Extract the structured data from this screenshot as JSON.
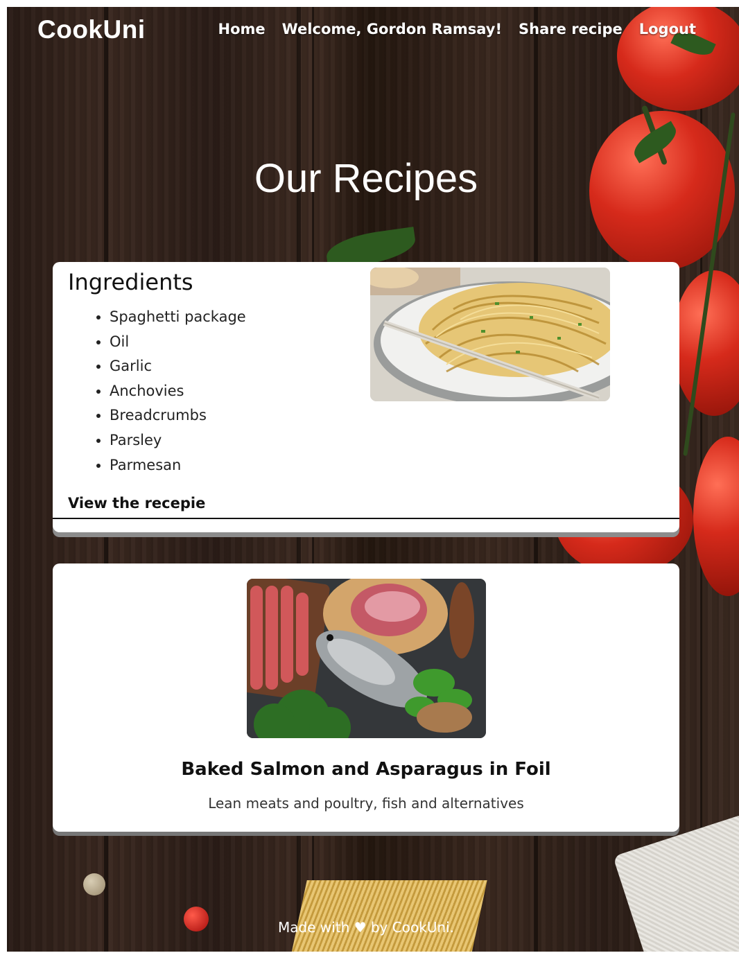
{
  "nav": {
    "logo": "CookUni",
    "links": [
      "Home",
      "Welcome, Gordon Ramsay!",
      "Share recipe",
      "Logout"
    ]
  },
  "main": {
    "title": "Our Recipes",
    "recipe_detail": {
      "ingredients_title": "Ingredients",
      "ingredients": [
        "Spaghetti package",
        "Oil",
        "Garlic",
        "Anchovies",
        "Breadcrumbs",
        "Parsley",
        "Parmesan"
      ],
      "view_link": "View the recepie"
    },
    "recipe_card": {
      "title": "Baked Salmon and Asparagus in Foil",
      "category": "Lean meats and poultry, fish and alternatives"
    }
  },
  "footer": {
    "prefix": "Made with",
    "heart": "♥",
    "suffix": "by CookUni."
  }
}
